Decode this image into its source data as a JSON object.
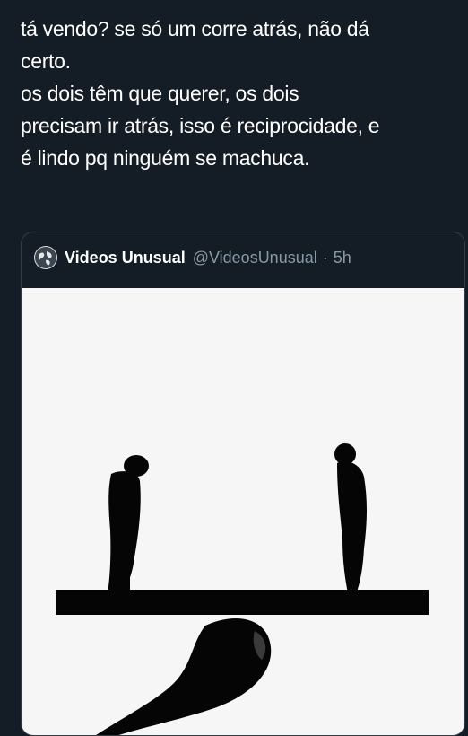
{
  "tweet": {
    "lines": [
      "tá vendo? se só um corre atrás, não dá",
      "certo.",
      "os dois têm que querer, os dois",
      "precisam ir atrás, isso é reciprocidade, e",
      "é lindo pq ninguém se machuca."
    ]
  },
  "quoted_tweet": {
    "display_name": "Videos Unusual",
    "handle": "@VideosUnusual",
    "separator": "·",
    "time": "5h",
    "avatar_icon": "globe-icon",
    "media_icon": "two-figures-on-balance-board-illustration"
  },
  "colors": {
    "background": "#141d26",
    "text": "#ffffff",
    "muted": "#8899a6",
    "border": "#2f3d4b",
    "media_background": "#f6f6f6"
  }
}
